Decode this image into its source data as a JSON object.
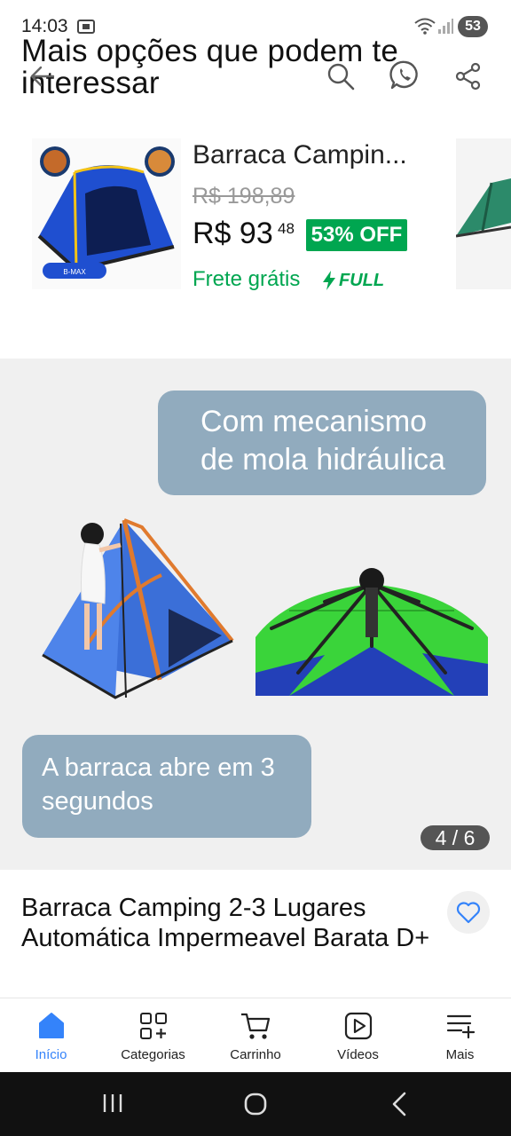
{
  "status_bar": {
    "time": "14:03",
    "battery": "53"
  },
  "header": {
    "section_title": "Mais opções que podem te interessar"
  },
  "recommendation": {
    "name": "Barraca Campin...",
    "old_price": "R$ 198,89",
    "price": "R$ 93",
    "price_cents": "48",
    "discount": "53% OFF",
    "shipping": "Frete grátis",
    "full_label": "FULL",
    "image_brand": "B-MAX"
  },
  "gallery": {
    "caption_top_line1": "Com mecanismo",
    "caption_top_line2": "de mola hidráulica",
    "caption_bottom_line1": "A barraca abre em 3",
    "caption_bottom_line2": "segundos",
    "counter": "4 / 6"
  },
  "product": {
    "title": "Barraca Camping 2-3 Lugares Automática Impermeavel Barata D+"
  },
  "bottom_nav": {
    "items": [
      {
        "label": "Início",
        "icon": "home-icon",
        "active": true
      },
      {
        "label": "Categorias",
        "icon": "categories-icon",
        "active": false
      },
      {
        "label": "Carrinho",
        "icon": "cart-icon",
        "active": false
      },
      {
        "label": "Vídeos",
        "icon": "video-icon",
        "active": false
      },
      {
        "label": "Mais",
        "icon": "menu-plus-icon",
        "active": false
      }
    ]
  },
  "colors": {
    "accent": "#3483fa",
    "green": "#00a650",
    "bubble": "#91abbe",
    "gallery_bg": "#f0f0f0"
  }
}
